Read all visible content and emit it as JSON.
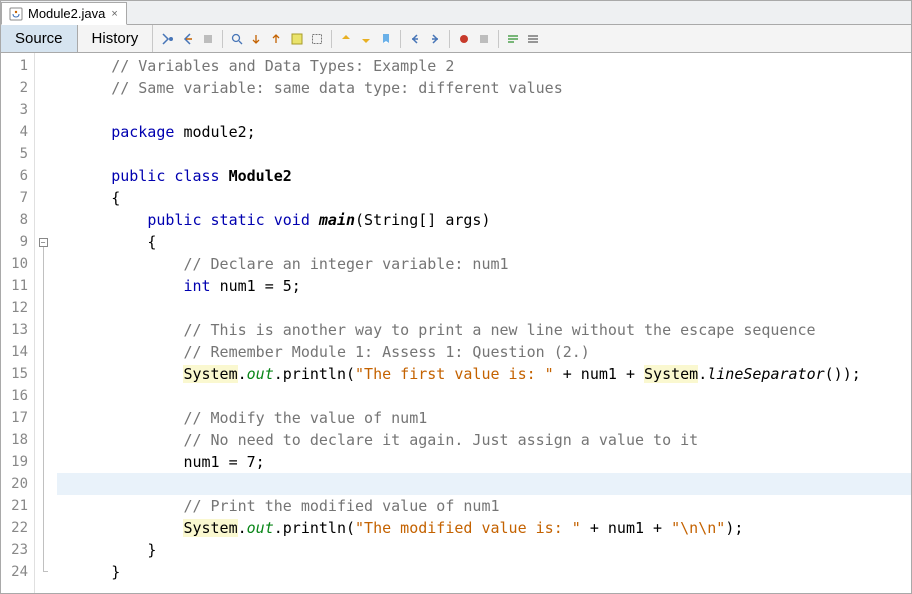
{
  "tab": {
    "filename": "Module2.java"
  },
  "subtabs": {
    "source": "Source",
    "history": "History"
  },
  "code": {
    "total_lines": 24,
    "lines": [
      {
        "n": 1,
        "tokens": [
          [
            "sp",
            "      "
          ],
          [
            "cm",
            "// Variables and Data Types: Example 2"
          ]
        ]
      },
      {
        "n": 2,
        "tokens": [
          [
            "sp",
            "      "
          ],
          [
            "cm",
            "// Same variable: same data type: different values"
          ]
        ]
      },
      {
        "n": 3,
        "tokens": []
      },
      {
        "n": 4,
        "tokens": [
          [
            "sp",
            "      "
          ],
          [
            "kw",
            "package"
          ],
          [
            "sp",
            " "
          ],
          [
            "id",
            "module2;"
          ]
        ]
      },
      {
        "n": 5,
        "tokens": []
      },
      {
        "n": 6,
        "tokens": [
          [
            "sp",
            "      "
          ],
          [
            "kw",
            "public"
          ],
          [
            "sp",
            " "
          ],
          [
            "kw",
            "class"
          ],
          [
            "sp",
            " "
          ],
          [
            "idb",
            "Module2"
          ]
        ]
      },
      {
        "n": 7,
        "tokens": [
          [
            "sp",
            "      "
          ],
          [
            "id",
            "{"
          ]
        ]
      },
      {
        "n": 8,
        "tokens": [
          [
            "sp",
            "          "
          ],
          [
            "kw",
            "public"
          ],
          [
            "sp",
            " "
          ],
          [
            "kw",
            "static"
          ],
          [
            "sp",
            " "
          ],
          [
            "kw",
            "void"
          ],
          [
            "sp",
            " "
          ],
          [
            "idbi",
            "main"
          ],
          [
            "id",
            "(String[] args)"
          ]
        ]
      },
      {
        "n": 9,
        "tokens": [
          [
            "sp",
            "          "
          ],
          [
            "id",
            "{"
          ]
        ]
      },
      {
        "n": 10,
        "tokens": [
          [
            "sp",
            "              "
          ],
          [
            "cm",
            "// Declare an integer variable: num1"
          ]
        ]
      },
      {
        "n": 11,
        "tokens": [
          [
            "sp",
            "              "
          ],
          [
            "kw",
            "int"
          ],
          [
            "sp",
            " "
          ],
          [
            "id",
            "num1 = 5;"
          ]
        ]
      },
      {
        "n": 12,
        "tokens": []
      },
      {
        "n": 13,
        "tokens": [
          [
            "sp",
            "              "
          ],
          [
            "cm",
            "// This is another way to print a new line without the escape sequence"
          ]
        ]
      },
      {
        "n": 14,
        "tokens": [
          [
            "sp",
            "              "
          ],
          [
            "cm",
            "// Remember Module 1: Assess 1: Question (2.)"
          ]
        ]
      },
      {
        "n": 15,
        "tokens": [
          [
            "sp",
            "              "
          ],
          [
            "hl",
            "System"
          ],
          [
            "id",
            "."
          ],
          [
            "itf",
            "out"
          ],
          [
            "id",
            ".println("
          ],
          [
            "str",
            "\"The first value is: \""
          ],
          [
            "id",
            " + num1 + "
          ],
          [
            "hl",
            "System"
          ],
          [
            "id",
            "."
          ],
          [
            "iti",
            "lineSeparator"
          ],
          [
            "id",
            "());"
          ]
        ]
      },
      {
        "n": 16,
        "tokens": []
      },
      {
        "n": 17,
        "tokens": [
          [
            "sp",
            "              "
          ],
          [
            "cm",
            "// Modify the value of num1"
          ]
        ]
      },
      {
        "n": 18,
        "tokens": [
          [
            "sp",
            "              "
          ],
          [
            "cm",
            "// No need to declare it again. Just assign a value to it"
          ]
        ]
      },
      {
        "n": 19,
        "tokens": [
          [
            "sp",
            "              "
          ],
          [
            "id",
            "num1 = 7;"
          ]
        ]
      },
      {
        "n": 20,
        "tokens": [],
        "current": true
      },
      {
        "n": 21,
        "tokens": [
          [
            "sp",
            "              "
          ],
          [
            "cm",
            "// Print the modified value of num1"
          ]
        ]
      },
      {
        "n": 22,
        "tokens": [
          [
            "sp",
            "              "
          ],
          [
            "hl",
            "System"
          ],
          [
            "id",
            "."
          ],
          [
            "itf",
            "out"
          ],
          [
            "id",
            ".println("
          ],
          [
            "str",
            "\"The modified value is: \""
          ],
          [
            "id",
            " + num1 + "
          ],
          [
            "str",
            "\"\\n\\n\""
          ],
          [
            "id",
            ");"
          ]
        ]
      },
      {
        "n": 23,
        "tokens": [
          [
            "sp",
            "          "
          ],
          [
            "id",
            "}"
          ]
        ]
      },
      {
        "n": 24,
        "tokens": [
          [
            "sp",
            "      "
          ],
          [
            "id",
            "}"
          ]
        ]
      }
    ],
    "fold": {
      "collapsible_at": 9,
      "line_from": 9,
      "line_to": 24
    }
  }
}
